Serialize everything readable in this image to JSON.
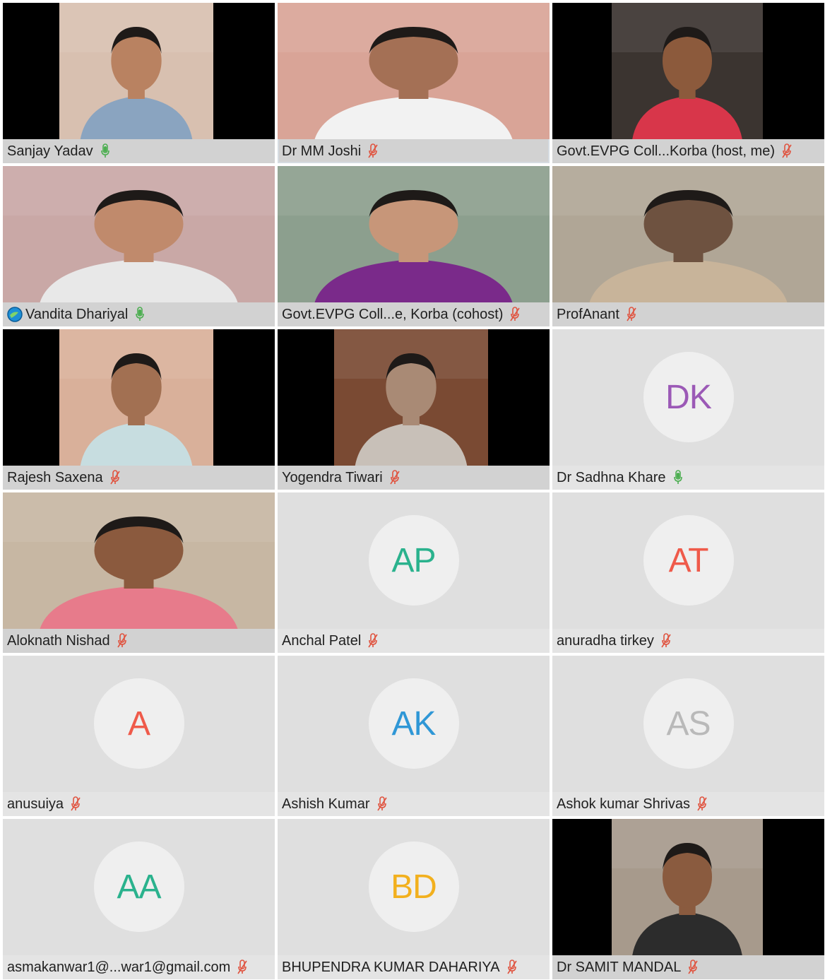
{
  "meeting": {
    "participants": [
      {
        "name": "Sanjay Yadav",
        "mic": "on",
        "video": true,
        "frame": "center",
        "bg": "#d8c0b0",
        "shirt": "#8aa4c0",
        "skin": "#b98261",
        "active": false
      },
      {
        "name": "Dr MM Joshi",
        "mic": "muted",
        "video": true,
        "frame": "full",
        "bg": "#d9a497",
        "shirt": "#f2f2f2",
        "skin": "#a47055",
        "active": true
      },
      {
        "name": "Govt.EVPG Coll...Korba (host, me)",
        "mic": "muted",
        "video": true,
        "frame": "center-wide",
        "bg": "#3b3430",
        "shirt": "#d8364a",
        "skin": "#8c5a3c",
        "active": false
      },
      {
        "name": "Vandita Dhariyal",
        "mic": "on",
        "video": true,
        "frame": "full",
        "bg": "#c9a8a6",
        "shirt": "#e8e8e8",
        "skin": "#c08a6c",
        "badge": "globe-icon",
        "active": false
      },
      {
        "name": "Govt.EVPG Coll...e, Korba (cohost)",
        "mic": "muted",
        "video": true,
        "frame": "full",
        "bg": "#8c9f8e",
        "shirt": "#7a2a8a",
        "skin": "#c79679",
        "active": false
      },
      {
        "name": "ProfAnant",
        "mic": "muted",
        "video": true,
        "frame": "full",
        "bg": "#b0a696",
        "shirt": "#c8b49a",
        "skin": "#6e5240",
        "active": false
      },
      {
        "name": "Rajesh Saxena",
        "mic": "muted",
        "video": true,
        "frame": "center",
        "bg": "#d9b09a",
        "shirt": "#c7dde0",
        "skin": "#a27052",
        "active": false
      },
      {
        "name": "Yogendra Tiwari",
        "mic": "muted",
        "video": true,
        "frame": "center",
        "bg": "#7a4a33",
        "shirt": "#c8c0b8",
        "skin": "#a98a75",
        "active": false
      },
      {
        "name": "Dr Sadhna Khare",
        "mic": "on",
        "video": false,
        "initials": "DK",
        "color": "#9b59b6"
      },
      {
        "name": "Aloknath Nishad",
        "mic": "muted",
        "video": true,
        "frame": "full",
        "bg": "#c7b7a3",
        "shirt": "#e77b8b",
        "skin": "#8b5a3e",
        "active": false
      },
      {
        "name": "Anchal Patel",
        "mic": "muted",
        "video": false,
        "initials": "AP",
        "color": "#2ab28d"
      },
      {
        "name": "anuradha tirkey",
        "mic": "muted",
        "video": false,
        "initials": "AT",
        "color": "#ef5a4a"
      },
      {
        "name": "anusuiya",
        "mic": "muted",
        "video": false,
        "initials": "A",
        "color": "#ef5a4a"
      },
      {
        "name": "Ashish Kumar",
        "mic": "muted",
        "video": false,
        "initials": "AK",
        "color": "#2f97d6"
      },
      {
        "name": "Ashok kumar Shrivas",
        "mic": "muted",
        "video": false,
        "initials": "AS",
        "color": "#b9b9b9"
      },
      {
        "name": "asmakanwar1@...war1@gmail.com",
        "mic": "muted",
        "video": false,
        "initials": "AA",
        "color": "#2ab28d"
      },
      {
        "name": "BHUPENDRA KUMAR DAHARIYA",
        "mic": "muted",
        "video": false,
        "initials": "BD",
        "color": "#f2b01e"
      },
      {
        "name": "Dr SAMIT MANDAL",
        "mic": "muted",
        "video": true,
        "frame": "center-wide",
        "bg": "#a79a8c",
        "shirt": "#2c2c2c",
        "skin": "#8a5b3f",
        "active": false
      }
    ]
  },
  "colors": {
    "mic_on": "#4cae50",
    "mic_muted": "#e0533f",
    "active_border": "#3a86c8"
  }
}
